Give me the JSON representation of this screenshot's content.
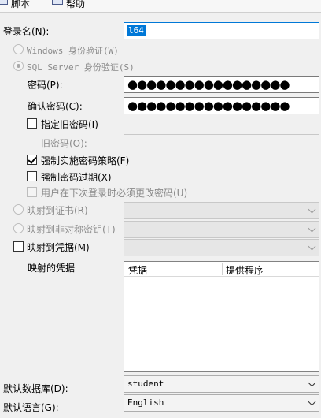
{
  "toolbar": {
    "script_label": "脚本",
    "help_label": "帮助"
  },
  "login": {
    "label": "登录名(N):",
    "value": "l64"
  },
  "auth": {
    "windows_label": "Windows 身份验证(W)",
    "sql_label": "SQL Server 身份验证(S)"
  },
  "password": {
    "label": "密码(P):",
    "confirm_label": "确认密码(C):",
    "masked": "●●●●●●●●●●●●●●●●●",
    "confirm_masked": "●●●●●●●●●●●●●●●●●"
  },
  "old_password": {
    "specify_label": "指定旧密码(I)",
    "label": "旧密码(O):"
  },
  "policy": {
    "enforce_policy_label": "强制实施密码策略(F)",
    "enforce_expiration_label": "强制密码过期(X)",
    "must_change_label": "用户在下次登录时必须更改密码(U)"
  },
  "mapping": {
    "cert_label": "映射到证书(R)",
    "asym_key_label": "映射到非对称密钥(T)",
    "credential_label": "映射到凭据(M)",
    "mapped_credentials_label": "映射的凭据",
    "columns": [
      "凭据",
      "提供程序"
    ]
  },
  "defaults": {
    "database_label": "默认数据库(D):",
    "database_value": "student",
    "language_label": "默认语言(G):",
    "language_value": "English"
  },
  "colors": {
    "accent": "#0078d7",
    "window_bg": "#f0f0f0"
  }
}
